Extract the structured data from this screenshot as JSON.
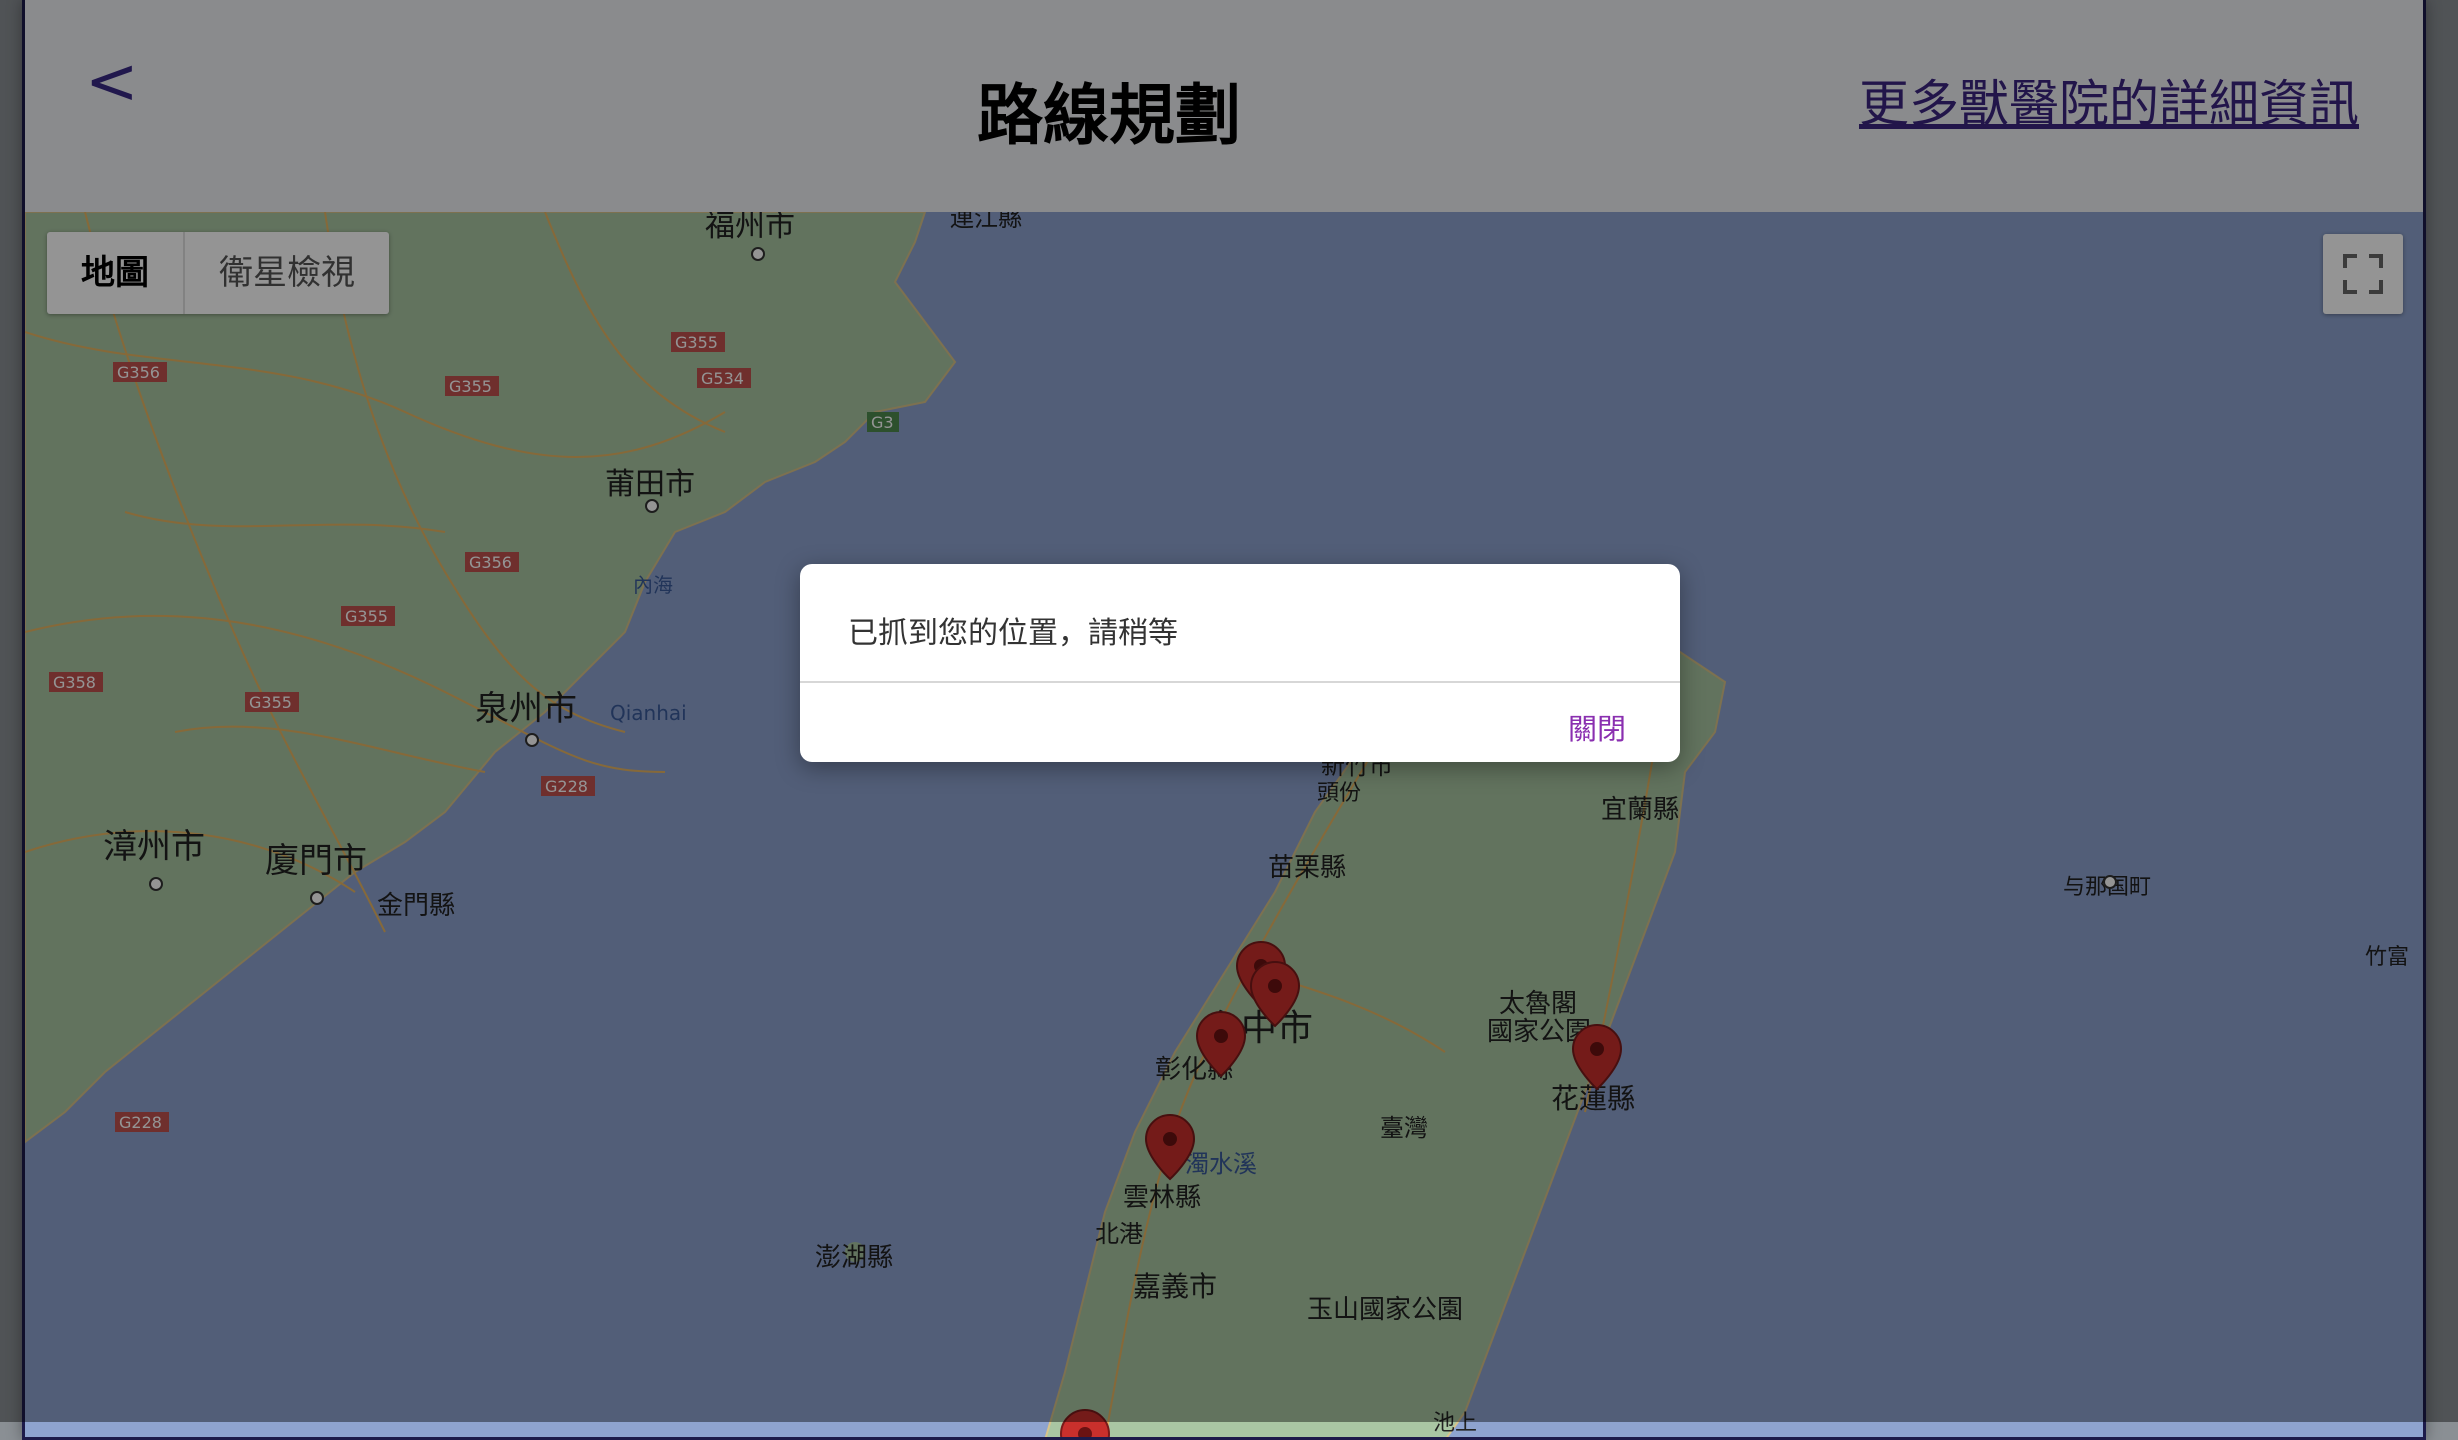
{
  "header": {
    "back_label": "<",
    "title": "路線規劃",
    "more_link": "更多獸醫院的詳細資訊"
  },
  "map": {
    "map_tab": "地圖",
    "satellite_tab": "衛星檢視",
    "place_labels": {
      "fuzhou": "福州市",
      "lianjiang": "連江縣",
      "putian": "莆田市",
      "neihai": "內海",
      "quanzhou": "泉州市",
      "qianhai": "Qianhai",
      "zhangzhou": "漳州市",
      "xiamen": "廈門市",
      "kinmen": "金門縣",
      "penghu": "澎湖縣",
      "xinzhu": "新竹市",
      "toufen": "頭份",
      "miaoli": "苗栗縣",
      "yilan": "宜蘭縣",
      "taichung": "台中市",
      "changhua": "彰化縣",
      "taroko": "太魯閣",
      "taroko_park": "國家公園",
      "hualien": "花蓮縣",
      "taiwan": "臺灣",
      "zhuoshui": "濁水溪",
      "yunlin": "雲林縣",
      "beigang": "北港",
      "chiayi": "嘉義市",
      "yushan": "玉山國家公園",
      "yonaguni": "与那国町",
      "taketomi": "竹富",
      "chishang": "池上"
    },
    "road_shields": {
      "g356a": "G356",
      "g355a": "G355",
      "g355b": "G355",
      "g534": "G534",
      "g3": "G3",
      "g356b": "G356",
      "g355c": "G355",
      "g358": "G358",
      "g355d": "G355",
      "g228a": "G228",
      "g228b": "G228"
    },
    "colors": {
      "sea": "#5b6e94",
      "land": "#6f8b70",
      "pin": "#8e2a2a"
    }
  },
  "dialog": {
    "message": "已抓到您的位置，請稍等",
    "close_label": "關閉"
  }
}
